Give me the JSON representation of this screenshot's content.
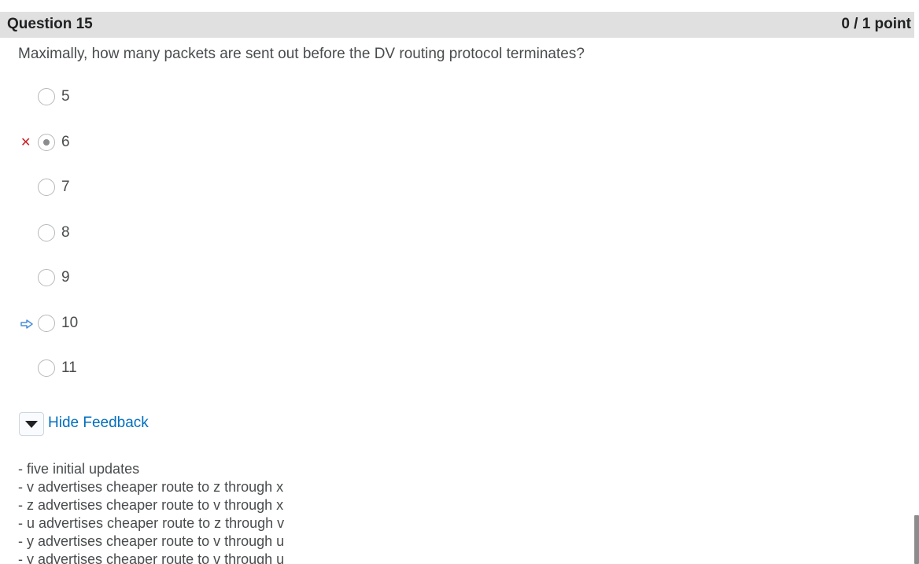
{
  "question": {
    "title": "Question 15",
    "score": "0 / 1 point",
    "text": "Maximally, how many packets are sent out before the DV routing protocol terminates?"
  },
  "options": [
    {
      "label": "5",
      "selected": false,
      "marker": null
    },
    {
      "label": "6",
      "selected": true,
      "marker": "incorrect-x"
    },
    {
      "label": "7",
      "selected": false,
      "marker": null
    },
    {
      "label": "8",
      "selected": false,
      "marker": null
    },
    {
      "label": "9",
      "selected": false,
      "marker": null
    },
    {
      "label": "10",
      "selected": false,
      "marker": "correct-answer-arrow"
    },
    {
      "label": "11",
      "selected": false,
      "marker": null
    }
  ],
  "feedback": {
    "toggle_label": "Hide Feedback",
    "lines": [
      "- five initial updates",
      "- v advertises cheaper route to z through x",
      "- z advertises cheaper route to v through x",
      "- u advertises cheaper route to z through v",
      "- y advertises cheaper route to v through u",
      "- y advertises cheaper route to v through u"
    ]
  },
  "colors": {
    "header_bg": "#e0e0e0",
    "wrong_mark": "#cd2026",
    "arrow": "#4a8ed8",
    "link": "#006fbf"
  }
}
